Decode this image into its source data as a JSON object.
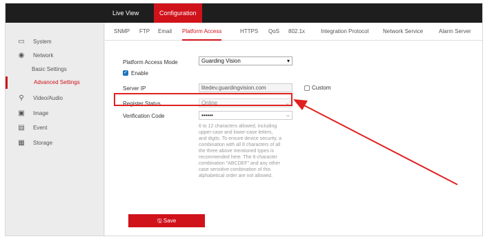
{
  "topbar": {
    "tabs": [
      "Live View",
      "Configuration"
    ],
    "active_tab": "Configuration"
  },
  "sidebar": {
    "items": [
      {
        "label": "System",
        "icon": "monitor-icon"
      },
      {
        "label": "Network",
        "icon": "globe-icon"
      },
      {
        "label": "Basic Settings",
        "sub": true
      },
      {
        "label": "Advanced Settings",
        "sub": true,
        "active": true
      },
      {
        "label": "Video/Audio",
        "icon": "video-icon"
      },
      {
        "label": "Image",
        "icon": "image-icon"
      },
      {
        "label": "Event",
        "icon": "calendar-icon"
      },
      {
        "label": "Storage",
        "icon": "storage-icon"
      }
    ]
  },
  "tabs": [
    "SNMP",
    "FTP",
    "Email",
    "Platform Access",
    "HTTPS",
    "QoS",
    "802.1x",
    "Integration Protocol",
    "Network Service",
    "Alarm Server"
  ],
  "active_tab": "Platform Access",
  "form": {
    "platform_access_mode_label": "Platform Access Mode",
    "platform_access_mode_value": "Guarding Vision",
    "enable_label": "Enable",
    "enable_checked": true,
    "server_ip_label": "Server IP",
    "server_ip_value": "litedev.guardingvision.com",
    "custom_label": "Custom",
    "custom_checked": false,
    "register_status_label": "Register Status",
    "register_status_value": "Online",
    "verification_code_label": "Verification Code",
    "verification_code_value": "••••••",
    "hint": "6 to 12 characters allowed, including upper-case and lower-case letters, and digits. To ensure device security, a combination with all 8 characters of all the three above mentioned types is recommended here. The 6-character combination \"ABCDEF\" and any other case sensitive combination of this alphabetical order are not allowed.",
    "save_label": "Save"
  },
  "colors": {
    "accent": "#d0121b",
    "highlight": "#e02020",
    "checkbox": "#1e73be"
  }
}
